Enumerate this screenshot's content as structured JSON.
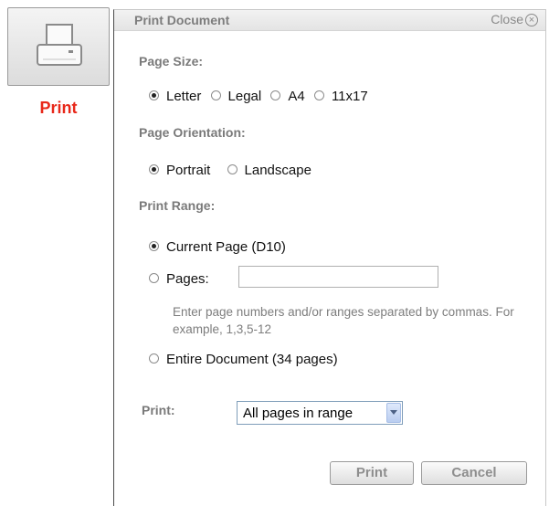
{
  "tool": {
    "label": "Print",
    "icon": "printer-icon"
  },
  "dialog": {
    "title": "Print Document",
    "close_label": "Close",
    "close_symbol": "×",
    "page_size": {
      "heading": "Page Size:",
      "options": [
        "Letter",
        "Legal",
        "A4",
        "11x17"
      ],
      "selected": "Letter"
    },
    "orientation": {
      "heading": "Page Orientation:",
      "options": [
        "Portrait",
        "Landscape"
      ],
      "selected": "Portrait"
    },
    "range": {
      "heading": "Print Range:",
      "current_page": "Current Page (D10)",
      "pages_label": "Pages:",
      "pages_value": "",
      "hint": "Enter page numbers and/or ranges separated by commas. For example, 1,3,5-12",
      "entire": "Entire Document (34 pages)",
      "selected": "Current Page (D10)"
    },
    "print_select": {
      "label": "Print:",
      "value": "All pages in range"
    },
    "buttons": {
      "print": "Print",
      "cancel": "Cancel"
    }
  }
}
